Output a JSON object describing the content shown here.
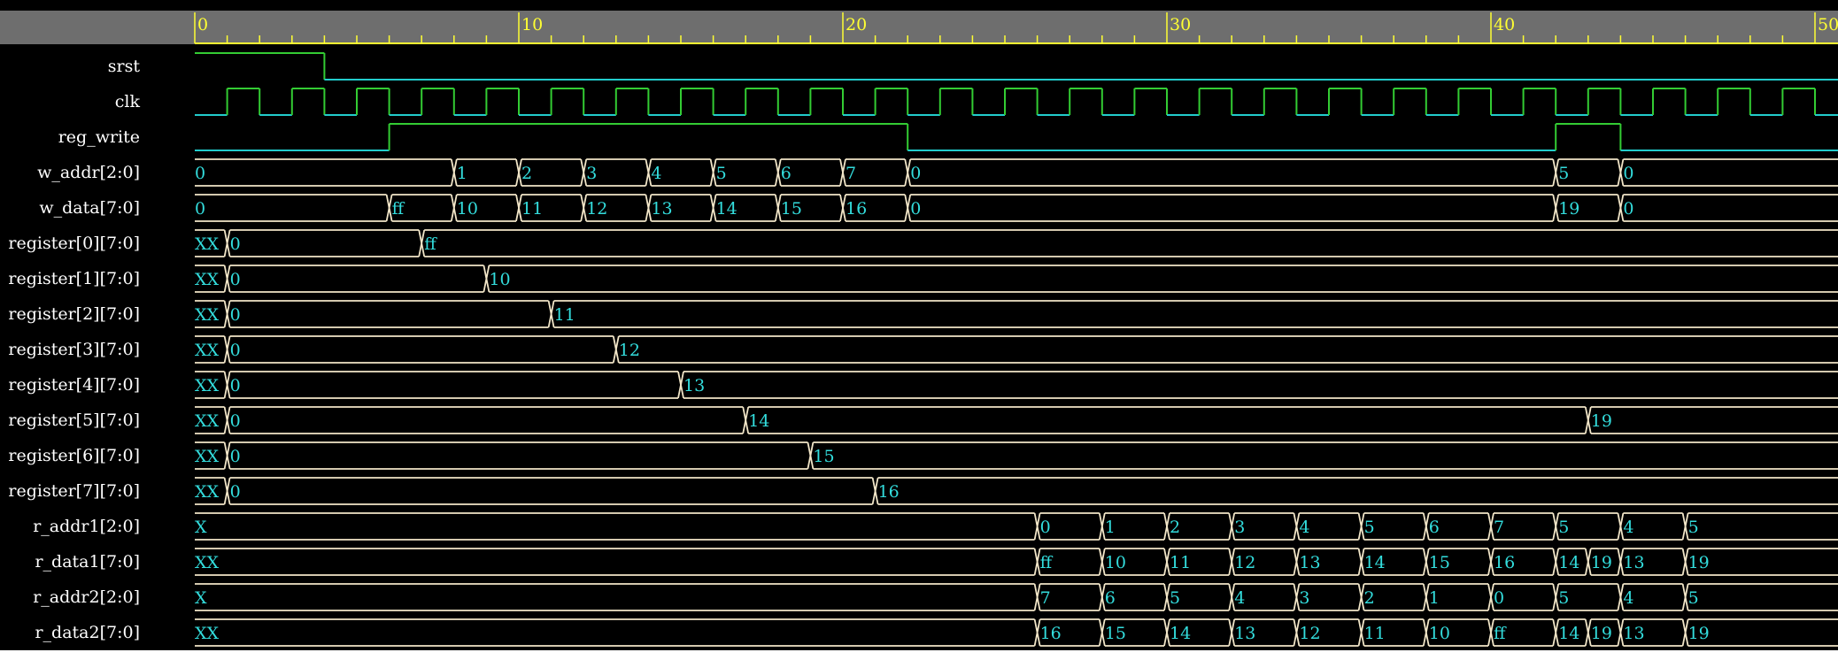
{
  "colors": {
    "background": "#000000",
    "ruler_bg": "#6e6e6e",
    "ruler_ticks": "#ffff33",
    "logic_high": "#33cc33",
    "logic_low": "#22cccc",
    "bus": "#f2e6c8",
    "value_text": "#33dddd",
    "signal_name": "#ffffff"
  },
  "timeline": {
    "start": 0,
    "end": 50,
    "major_every": 10,
    "minor_every": 1,
    "labels": [
      "0",
      "10",
      "20",
      "30",
      "40",
      "50"
    ]
  },
  "signals": [
    {
      "name": "srst",
      "kind": "bit",
      "changes": [
        [
          0,
          1
        ],
        [
          4,
          0
        ]
      ]
    },
    {
      "name": "clk",
      "kind": "clock",
      "first_rise": 1,
      "period": 2
    },
    {
      "name": "reg_write",
      "kind": "bit",
      "changes": [
        [
          0,
          0
        ],
        [
          6,
          1
        ],
        [
          22,
          0
        ],
        [
          42,
          1
        ],
        [
          44,
          0
        ]
      ]
    },
    {
      "name": "w_addr[2:0]",
      "kind": "bus",
      "changes": [
        [
          0,
          "0"
        ],
        [
          8,
          "1"
        ],
        [
          10,
          "2"
        ],
        [
          12,
          "3"
        ],
        [
          14,
          "4"
        ],
        [
          16,
          "5"
        ],
        [
          18,
          "6"
        ],
        [
          20,
          "7"
        ],
        [
          22,
          "0"
        ],
        [
          42,
          "5"
        ],
        [
          44,
          "0"
        ]
      ]
    },
    {
      "name": "w_data[7:0]",
      "kind": "bus",
      "changes": [
        [
          0,
          "0"
        ],
        [
          6,
          "ff"
        ],
        [
          8,
          "10"
        ],
        [
          10,
          "11"
        ],
        [
          12,
          "12"
        ],
        [
          14,
          "13"
        ],
        [
          16,
          "14"
        ],
        [
          18,
          "15"
        ],
        [
          20,
          "16"
        ],
        [
          22,
          "0"
        ],
        [
          42,
          "19"
        ],
        [
          44,
          "0"
        ]
      ]
    },
    {
      "name": "register[0][7:0]",
      "kind": "bus",
      "changes": [
        [
          0,
          "XX"
        ],
        [
          1,
          "0"
        ],
        [
          7,
          "ff"
        ]
      ]
    },
    {
      "name": "register[1][7:0]",
      "kind": "bus",
      "changes": [
        [
          0,
          "XX"
        ],
        [
          1,
          "0"
        ],
        [
          9,
          "10"
        ]
      ]
    },
    {
      "name": "register[2][7:0]",
      "kind": "bus",
      "changes": [
        [
          0,
          "XX"
        ],
        [
          1,
          "0"
        ],
        [
          11,
          "11"
        ]
      ]
    },
    {
      "name": "register[3][7:0]",
      "kind": "bus",
      "changes": [
        [
          0,
          "XX"
        ],
        [
          1,
          "0"
        ],
        [
          13,
          "12"
        ]
      ]
    },
    {
      "name": "register[4][7:0]",
      "kind": "bus",
      "changes": [
        [
          0,
          "XX"
        ],
        [
          1,
          "0"
        ],
        [
          15,
          "13"
        ]
      ]
    },
    {
      "name": "register[5][7:0]",
      "kind": "bus",
      "changes": [
        [
          0,
          "XX"
        ],
        [
          1,
          "0"
        ],
        [
          17,
          "14"
        ],
        [
          43,
          "19"
        ]
      ]
    },
    {
      "name": "register[6][7:0]",
      "kind": "bus",
      "changes": [
        [
          0,
          "XX"
        ],
        [
          1,
          "0"
        ],
        [
          19,
          "15"
        ]
      ]
    },
    {
      "name": "register[7][7:0]",
      "kind": "bus",
      "changes": [
        [
          0,
          "XX"
        ],
        [
          1,
          "0"
        ],
        [
          21,
          "16"
        ]
      ]
    },
    {
      "name": "r_addr1[2:0]",
      "kind": "bus",
      "changes": [
        [
          0,
          "X"
        ],
        [
          26,
          "0"
        ],
        [
          28,
          "1"
        ],
        [
          30,
          "2"
        ],
        [
          32,
          "3"
        ],
        [
          34,
          "4"
        ],
        [
          36,
          "5"
        ],
        [
          38,
          "6"
        ],
        [
          40,
          "7"
        ],
        [
          42,
          "5"
        ],
        [
          44,
          "4"
        ],
        [
          46,
          "5"
        ]
      ]
    },
    {
      "name": "r_data1[7:0]",
      "kind": "bus",
      "changes": [
        [
          0,
          "XX"
        ],
        [
          26,
          "ff"
        ],
        [
          28,
          "10"
        ],
        [
          30,
          "11"
        ],
        [
          32,
          "12"
        ],
        [
          34,
          "13"
        ],
        [
          36,
          "14"
        ],
        [
          38,
          "15"
        ],
        [
          40,
          "16"
        ],
        [
          42,
          "14"
        ],
        [
          43,
          "19"
        ],
        [
          44,
          "13"
        ],
        [
          46,
          "19"
        ]
      ]
    },
    {
      "name": "r_addr2[2:0]",
      "kind": "bus",
      "changes": [
        [
          0,
          "X"
        ],
        [
          26,
          "7"
        ],
        [
          28,
          "6"
        ],
        [
          30,
          "5"
        ],
        [
          32,
          "4"
        ],
        [
          34,
          "3"
        ],
        [
          36,
          "2"
        ],
        [
          38,
          "1"
        ],
        [
          40,
          "0"
        ],
        [
          42,
          "5"
        ],
        [
          44,
          "4"
        ],
        [
          46,
          "5"
        ]
      ]
    },
    {
      "name": "r_data2[7:0]",
      "kind": "bus",
      "changes": [
        [
          0,
          "XX"
        ],
        [
          26,
          "16"
        ],
        [
          28,
          "15"
        ],
        [
          30,
          "14"
        ],
        [
          32,
          "13"
        ],
        [
          34,
          "12"
        ],
        [
          36,
          "11"
        ],
        [
          38,
          "10"
        ],
        [
          40,
          "ff"
        ],
        [
          42,
          "14"
        ],
        [
          43,
          "19"
        ],
        [
          44,
          "13"
        ],
        [
          46,
          "19"
        ]
      ]
    }
  ]
}
